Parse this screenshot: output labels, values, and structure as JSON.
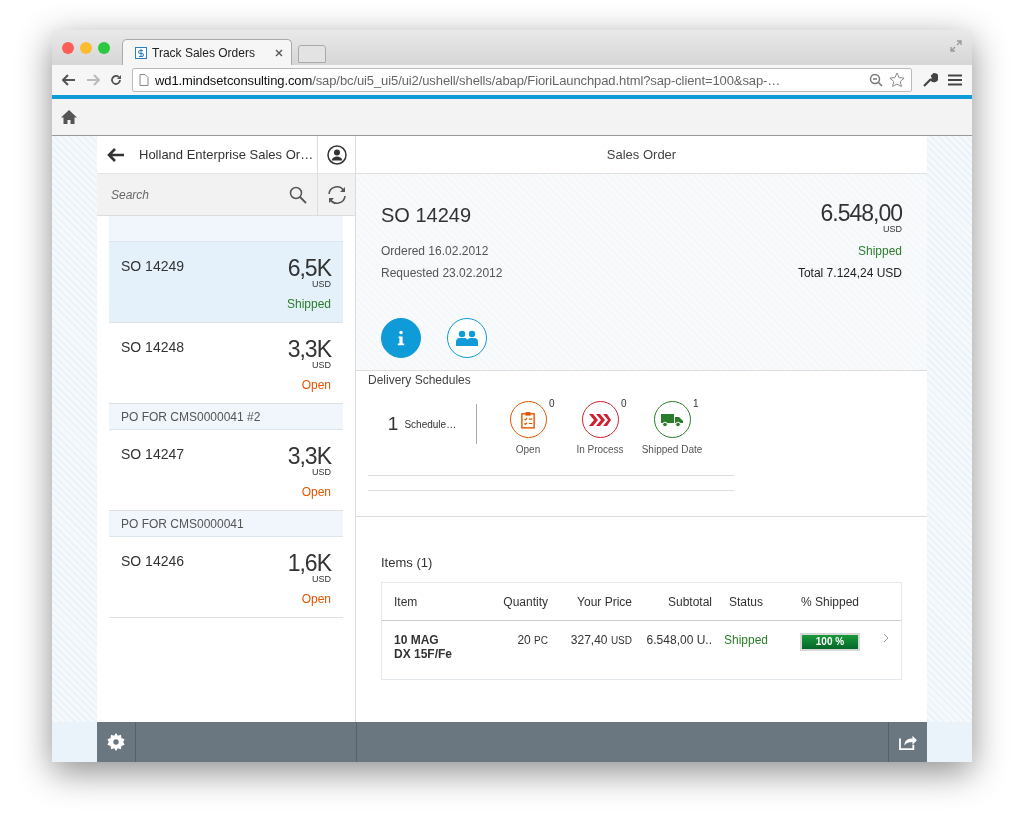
{
  "browser": {
    "tab_title": "Track Sales Orders",
    "url_host": "wd1.mindsetconsulting.com",
    "url_path": "/sap/bc/ui5_ui5/ui2/ushell/shells/abap/FioriLaunchpad.html?sap-client=100&sap-…"
  },
  "master": {
    "title": "Holland Enterprise Sales Or…",
    "search": {
      "placeholder": "Search"
    },
    "list": [
      {
        "kind": "order",
        "number": "SO 14249",
        "amount": "6,5K",
        "currency": "USD",
        "status": "Shipped",
        "color": "#2b7d2b",
        "selected": true
      },
      {
        "kind": "order",
        "number": "SO 14248",
        "amount": "3,3K",
        "currency": "USD",
        "status": "Open",
        "color": "#e35500",
        "selected": false
      },
      {
        "kind": "group",
        "label": "PO FOR CMS0000041 #2"
      },
      {
        "kind": "order",
        "number": "SO 14247",
        "amount": "3,3K",
        "currency": "USD",
        "status": "Open",
        "color": "#e35500",
        "selected": false
      },
      {
        "kind": "group",
        "label": "PO FOR CMS0000041"
      },
      {
        "kind": "order",
        "number": "SO 14246",
        "amount": "1,6K",
        "currency": "USD",
        "status": "Open",
        "color": "#e35500",
        "selected": false
      }
    ]
  },
  "detail": {
    "title": "Sales Order",
    "header": {
      "number": "SO 14249",
      "amount": "6.548,00",
      "currency": "USD",
      "ordered": "Ordered 16.02.2012",
      "requested": "Requested 23.02.2012",
      "status": "Shipped",
      "color": "#2b7d2b",
      "total": "Total 7.124,24 USD"
    },
    "icon_tabs": [
      {
        "kind": "info",
        "selected": true
      },
      {
        "kind": "contacts",
        "selected": false
      }
    ],
    "delivery": {
      "label": "Delivery Schedules",
      "count": "1",
      "count_label": "Schedule…",
      "stages": [
        {
          "kind": "open",
          "label": "Open",
          "count": "0",
          "color": "#e35500"
        },
        {
          "kind": "process",
          "label": "In Process",
          "count": "0",
          "color": "#d32030"
        },
        {
          "kind": "shipped",
          "label": "Shipped Date",
          "count": "1",
          "color": "#2b7d2b"
        }
      ]
    },
    "items": {
      "title": "Items (1)",
      "columns": [
        "Item",
        "Quantity",
        "Your Price",
        "Subtotal",
        "Status",
        "% Shipped"
      ],
      "rows": [
        {
          "item": "10 MAG DX 15F/Fe",
          "quantity": "20",
          "quantity_unit": "PC",
          "price": "327,40",
          "price_unit": "USD",
          "subtotal": "6.548,00 U..",
          "status": "Shipped",
          "color": "#2b7d2b",
          "level": 1,
          "level_label": "100 %"
        }
      ]
    }
  }
}
